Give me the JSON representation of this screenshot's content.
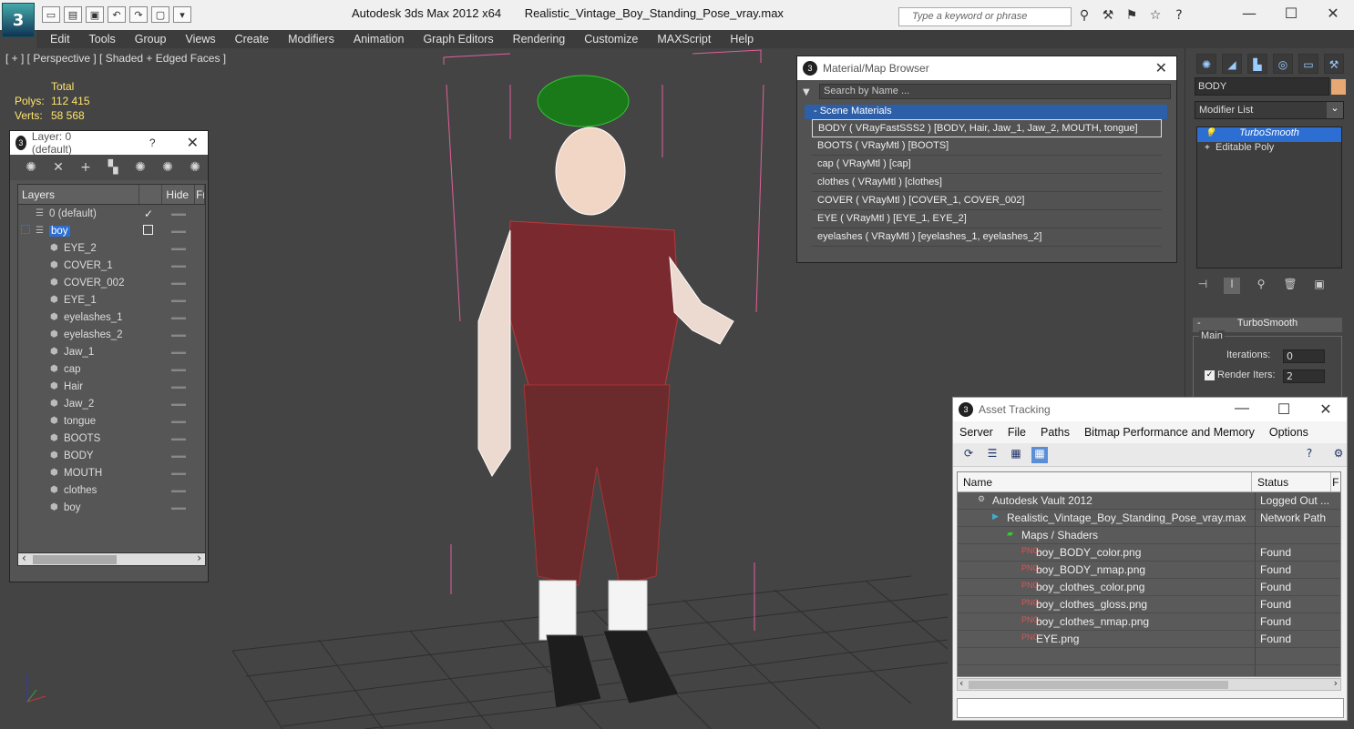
{
  "app": {
    "title": "Autodesk 3ds Max  2012 x64",
    "filename": "Realistic_Vintage_Boy_Standing_Pose_vray.max",
    "search_placeholder": "Type a keyword or phrase"
  },
  "menu": [
    "Edit",
    "Tools",
    "Group",
    "Views",
    "Create",
    "Modifiers",
    "Animation",
    "Graph Editors",
    "Rendering",
    "Customize",
    "MAXScript",
    "Help"
  ],
  "viewport": {
    "label": "[ + ] [ Perspective ] [ Shaded + Edged Faces ]",
    "stats_header": "Total",
    "polys_label": "Polys:",
    "polys_value": "112 415",
    "verts_label": "Verts:",
    "verts_value": "58 568"
  },
  "layer_panel": {
    "title": "Layer: 0 (default)",
    "help": "?",
    "col_layers": "Layers",
    "col_hide": "Hide",
    "col_fr": "Fr",
    "rows": [
      {
        "name": "0 (default)",
        "indent": 0,
        "checked": true
      },
      {
        "name": "boy",
        "indent": 0,
        "selected": true
      },
      {
        "name": "EYE_2",
        "indent": 1
      },
      {
        "name": "COVER_1",
        "indent": 1
      },
      {
        "name": "COVER_002",
        "indent": 1
      },
      {
        "name": "EYE_1",
        "indent": 1
      },
      {
        "name": "eyelashes_1",
        "indent": 1
      },
      {
        "name": "eyelashes_2",
        "indent": 1
      },
      {
        "name": "Jaw_1",
        "indent": 1
      },
      {
        "name": "cap",
        "indent": 1
      },
      {
        "name": "Hair",
        "indent": 1
      },
      {
        "name": "Jaw_2",
        "indent": 1
      },
      {
        "name": "tongue",
        "indent": 1
      },
      {
        "name": "BOOTS",
        "indent": 1
      },
      {
        "name": "BODY",
        "indent": 1
      },
      {
        "name": "MOUTH",
        "indent": 1
      },
      {
        "name": "clothes",
        "indent": 1
      },
      {
        "name": "boy",
        "indent": 1
      }
    ]
  },
  "material_browser": {
    "title": "Material/Map Browser",
    "search_placeholder": "Search by Name ...",
    "group": "- Scene Materials",
    "items": [
      "BODY  ( VRayFastSSS2 )  [BODY, Hair, Jaw_1, Jaw_2, MOUTH, tongue]",
      "BOOTS  ( VRayMtl )  [BOOTS]",
      "cap  ( VRayMtl )  [cap]",
      "clothes  ( VRayMtl )  [clothes]",
      "COVER  ( VRayMtl )  [COVER_1, COVER_002]",
      "EYE  ( VRayMtl )  [EYE_1, EYE_2]",
      "eyelashes  ( VRayMtl )  [eyelashes_1, eyelashes_2]"
    ]
  },
  "command_panel": {
    "object_name": "BODY",
    "modifier_list": "Modifier List",
    "stack": [
      "TurboSmooth",
      "Editable Poly"
    ],
    "rollout": "TurboSmooth",
    "group_main": "Main",
    "iterations_label": "Iterations:",
    "iterations_value": "0",
    "render_iters_label": "Render Iters:",
    "render_iters_value": "2"
  },
  "asset_tracking": {
    "title": "Asset Tracking",
    "menu": [
      "Server",
      "File",
      "Paths",
      "Bitmap Performance and Memory",
      "Options"
    ],
    "col_name": "Name",
    "col_status": "Status",
    "col_extra": "F",
    "rows": [
      {
        "name": "Autodesk Vault 2012",
        "status": "Logged Out ...",
        "indent": 1
      },
      {
        "name": "Realistic_Vintage_Boy_Standing_Pose_vray.max",
        "status": "Network Path",
        "indent": 2
      },
      {
        "name": "Maps / Shaders",
        "status": "",
        "indent": 3
      },
      {
        "name": "boy_BODY_color.png",
        "status": "Found",
        "indent": 4
      },
      {
        "name": "boy_BODY_nmap.png",
        "status": "Found",
        "indent": 4
      },
      {
        "name": "boy_clothes_color.png",
        "status": "Found",
        "indent": 4
      },
      {
        "name": "boy_clothes_gloss.png",
        "status": "Found",
        "indent": 4
      },
      {
        "name": "boy_clothes_nmap.png",
        "status": "Found",
        "indent": 4
      },
      {
        "name": "EYE.png",
        "status": "Found",
        "indent": 4
      },
      {
        "name": "",
        "status": "",
        "indent": 0
      },
      {
        "name": "",
        "status": "",
        "indent": 0
      }
    ]
  },
  "colors": {
    "selection": "#2c6ed2",
    "stats_text": "#ffe46b",
    "object_color": "#e8a874"
  }
}
